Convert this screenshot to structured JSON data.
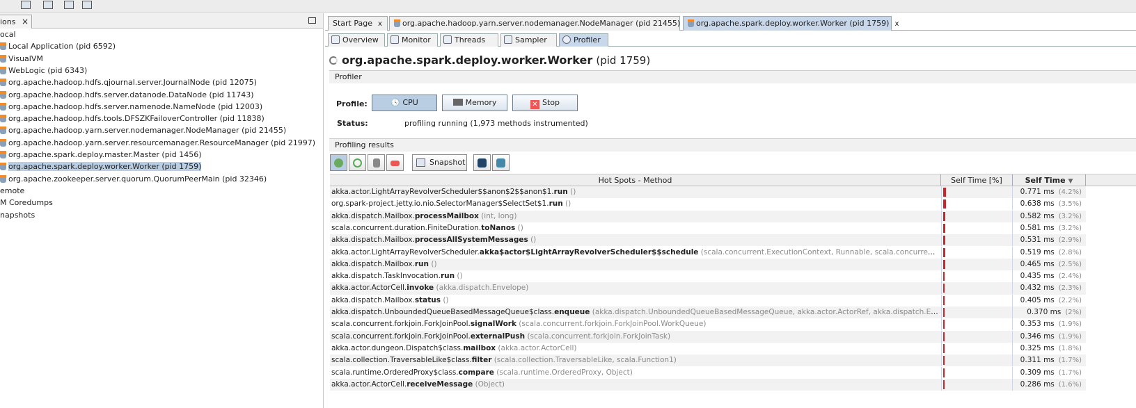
{
  "left_panel": {
    "tab_label": "ions",
    "close": "×",
    "tree": [
      {
        "label": "ocal",
        "indent": 0,
        "icon": "none"
      },
      {
        "label": "Local Application (pid 6592)",
        "icon": "java-cup-icon"
      },
      {
        "label": "VisualVM",
        "icon": "visualvm-icon"
      },
      {
        "label": "WebLogic (pid 6343)",
        "icon": "weblogic-icon"
      },
      {
        "label": "org.apache.hadoop.hdfs.qjournal.server.JournalNode (pid 12075)",
        "icon": "java-cup-icon"
      },
      {
        "label": "org.apache.hadoop.hdfs.server.datanode.DataNode (pid 11743)",
        "icon": "java-cup-icon"
      },
      {
        "label": "org.apache.hadoop.hdfs.server.namenode.NameNode (pid 12003)",
        "icon": "java-cup-icon"
      },
      {
        "label": "org.apache.hadoop.hdfs.tools.DFSZKFailoverController (pid 11838)",
        "icon": "java-cup-icon"
      },
      {
        "label": "org.apache.hadoop.yarn.server.nodemanager.NodeManager (pid 21455)",
        "icon": "java-cup-icon"
      },
      {
        "label": "org.apache.hadoop.yarn.server.resourcemanager.ResourceManager (pid 21997)",
        "icon": "java-cup-icon"
      },
      {
        "label": "org.apache.spark.deploy.master.Master (pid 1456)",
        "icon": "java-cup-icon"
      },
      {
        "label": "org.apache.spark.deploy.worker.Worker (pid 1759)",
        "icon": "java-cup-icon",
        "selected": true
      },
      {
        "label": "org.apache.zookeeper.server.quorum.QuorumPeerMain (pid 32346)",
        "icon": "java-cup-icon"
      },
      {
        "label": "emote",
        "icon": "none"
      },
      {
        "label": "M Coredumps",
        "icon": "none"
      },
      {
        "label": "napshots",
        "icon": "none"
      }
    ]
  },
  "doc_tabs": [
    {
      "label": "Start Page",
      "close": "x"
    },
    {
      "label": "org.apache.hadoop.yarn.server.nodemanager.NodeManager (pid 21455)",
      "close": "x"
    },
    {
      "label": "org.apache.spark.deploy.worker.Worker (pid 1759)",
      "close": "x",
      "active": true
    }
  ],
  "sub_tabs": [
    {
      "label": "Overview"
    },
    {
      "label": "Monitor"
    },
    {
      "label": "Threads"
    },
    {
      "label": "Sampler"
    },
    {
      "label": "Profiler",
      "active": true
    }
  ],
  "title": {
    "name": "org.apache.spark.deploy.worker.Worker",
    "pid": "(pid 1759)"
  },
  "profiler": {
    "section": "Profiler",
    "profile_label": "Profile:",
    "cpu": "CPU",
    "memory": "Memory",
    "stop": "Stop",
    "status_label": "Status:",
    "status": "profiling running (1,973 methods instrumented)"
  },
  "results": {
    "section": "Profiling results",
    "snapshot": "Snapshot",
    "columns": [
      "Hot Spots - Method",
      "Self Time [%]",
      "Self Time"
    ],
    "rows": [
      {
        "pkg": "akka.actor.LightArrayRevolverScheduler$$anon$2$$anon$1.",
        "method": "run",
        "args": " ()",
        "time": "0.771 ms",
        "pct": "(4.2%)",
        "value": 4.2
      },
      {
        "pkg": "org.spark-project.jetty.io.nio.SelectorManager$SelectSet$1.",
        "method": "run",
        "args": " ()",
        "time": "0.638 ms",
        "pct": "(3.5%)",
        "value": 3.5
      },
      {
        "pkg": "akka.dispatch.Mailbox.",
        "method": "processMailbox",
        "args": " (int, long)",
        "time": "0.582 ms",
        "pct": "(3.2%)",
        "value": 3.2
      },
      {
        "pkg": "scala.concurrent.duration.FiniteDuration.",
        "method": "toNanos",
        "args": " ()",
        "time": "0.581 ms",
        "pct": "(3.2%)",
        "value": 3.2
      },
      {
        "pkg": "akka.dispatch.Mailbox.",
        "method": "processAllSystemMessages",
        "args": " ()",
        "time": "0.531 ms",
        "pct": "(2.9%)",
        "value": 2.9
      },
      {
        "pkg": "akka.actor.LightArrayRevolverScheduler.",
        "method": "akka$actor$LightArrayRevolverScheduler$$schedule",
        "args": " (scala.concurrent.ExecutionContext, Runnable, scala.concurrent.duratio...",
        "time": "0.519 ms",
        "pct": "(2.8%)",
        "value": 2.8
      },
      {
        "pkg": "akka.dispatch.Mailbox.",
        "method": "run",
        "args": " ()",
        "time": "0.465 ms",
        "pct": "(2.5%)",
        "value": 2.5
      },
      {
        "pkg": "akka.dispatch.TaskInvocation.",
        "method": "run",
        "args": " ()",
        "time": "0.435 ms",
        "pct": "(2.4%)",
        "value": 2.4
      },
      {
        "pkg": "akka.actor.ActorCell.",
        "method": "invoke",
        "args": " (akka.dispatch.Envelope)",
        "time": "0.432 ms",
        "pct": "(2.3%)",
        "value": 2.3
      },
      {
        "pkg": "akka.dispatch.Mailbox.",
        "method": "status",
        "args": " ()",
        "time": "0.405 ms",
        "pct": "(2.2%)",
        "value": 2.2
      },
      {
        "pkg": "akka.dispatch.UnboundedQueueBasedMessageQueue$class.",
        "method": "enqueue",
        "args": " (akka.dispatch.UnboundedQueueBasedMessageQueue, akka.actor.ActorRef, akka.dispatch.Envelope)",
        "time": "0.370 ms",
        "pct": "(2%)",
        "value": 2.0
      },
      {
        "pkg": "scala.concurrent.forkjoin.ForkJoinPool.",
        "method": "signalWork",
        "args": " (scala.concurrent.forkjoin.ForkJoinPool.WorkQueue)",
        "time": "0.353 ms",
        "pct": "(1.9%)",
        "value": 1.9
      },
      {
        "pkg": "scala.concurrent.forkjoin.ForkJoinPool.",
        "method": "externalPush",
        "args": " (scala.concurrent.forkjoin.ForkJoinTask)",
        "time": "0.346 ms",
        "pct": "(1.9%)",
        "value": 1.9
      },
      {
        "pkg": "akka.actor.dungeon.Dispatch$class.",
        "method": "mailbox",
        "args": " (akka.actor.ActorCell)",
        "time": "0.325 ms",
        "pct": "(1.8%)",
        "value": 1.8
      },
      {
        "pkg": "scala.collection.TraversableLike$class.",
        "method": "filter",
        "args": " (scala.collection.TraversableLike, scala.Function1)",
        "time": "0.311 ms",
        "pct": "(1.7%)",
        "value": 1.7
      },
      {
        "pkg": "scala.runtime.OrderedProxy$class.",
        "method": "compare",
        "args": " (scala.runtime.OrderedProxy, Object)",
        "time": "0.309 ms",
        "pct": "(1.7%)",
        "value": 1.7
      },
      {
        "pkg": "akka.actor.ActorCell.",
        "method": "receiveMessage",
        "args": " (Object)",
        "time": "0.286 ms",
        "pct": "(1.6%)",
        "value": 1.6
      }
    ]
  },
  "colors": {
    "bar": "#c6272b",
    "selection": "#b9cde3"
  }
}
